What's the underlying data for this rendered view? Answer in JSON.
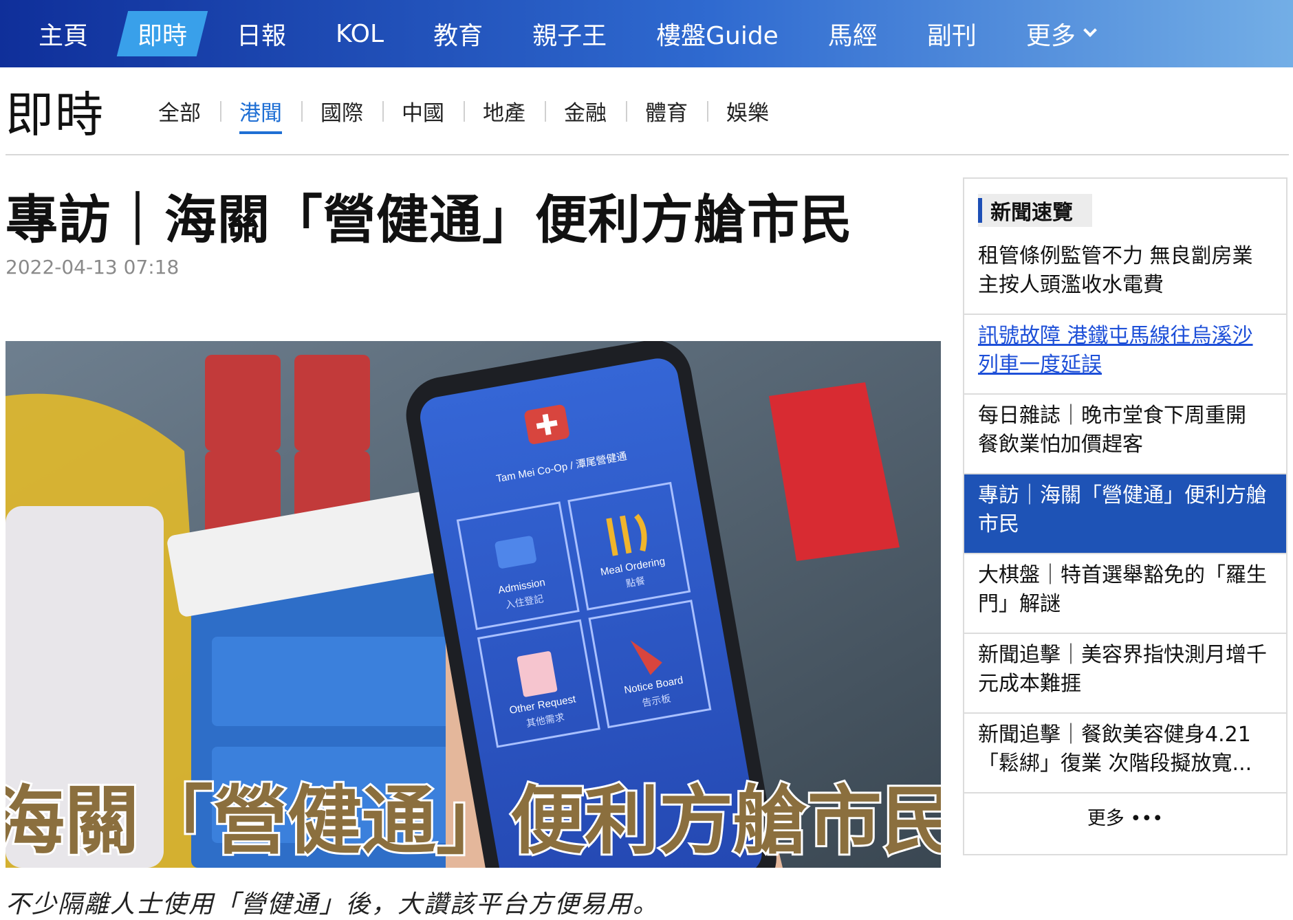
{
  "top_nav": {
    "items": [
      {
        "label": "主頁"
      },
      {
        "label": "即時"
      },
      {
        "label": "日報"
      },
      {
        "label": "KOL"
      },
      {
        "label": "教育"
      },
      {
        "label": "親子王"
      },
      {
        "label": "樓盤Guide"
      },
      {
        "label": "馬經"
      },
      {
        "label": "副刊"
      },
      {
        "label": "更多"
      }
    ],
    "active_index": 1,
    "more_icon": "chevron-down-icon"
  },
  "section": {
    "title": "即時",
    "tabs": [
      {
        "label": "全部"
      },
      {
        "label": "港聞"
      },
      {
        "label": "國際"
      },
      {
        "label": "中國"
      },
      {
        "label": "地產"
      },
      {
        "label": "金融"
      },
      {
        "label": "體育"
      },
      {
        "label": "娛樂"
      }
    ],
    "active_tab": "港聞"
  },
  "article": {
    "headline": "專訪｜海關「營健通」便利方艙市民",
    "date": "2022-04-13 07:18",
    "caption": "不少隔離人士使用「營健通」後，大讚該平台方便易用。",
    "image": {
      "overlay_text": "海關「營健通」便利方艙市民",
      "app_title": "Tam Mei Co-Op / 潭尾營健通",
      "tiles": [
        {
          "en": "Admission",
          "zh": "入住登記"
        },
        {
          "en": "Meal Ordering",
          "zh": "點餐"
        },
        {
          "en": "Other Request",
          "zh": "其他需求"
        },
        {
          "en": "Notice Board",
          "zh": "告示板"
        }
      ]
    }
  },
  "sidebar": {
    "title": "新聞速覽",
    "items": [
      {
        "text": "租管條例監管不力 無良劏房業主按人頭濫收水電費",
        "style": "normal"
      },
      {
        "text": "訊號故障 港鐵屯馬線往烏溪沙列車一度延誤",
        "style": "link"
      },
      {
        "text": "每日雜誌｜晚市堂食下周重開 餐飲業怕加價趕客",
        "style": "normal"
      },
      {
        "text": "專訪｜海關「營健通」便利方艙市民",
        "style": "active"
      },
      {
        "text": "大棋盤｜特首選舉豁免的「羅生門」解謎",
        "style": "normal"
      },
      {
        "text": "新聞追擊｜美容界指快測月增千元成本難捱",
        "style": "normal"
      },
      {
        "text": "新聞追擊｜餐飲美容健身4.21「鬆綁」復業 次階段擬放寬...",
        "style": "normal"
      }
    ],
    "more_label": "更多 •••"
  },
  "colors": {
    "nav_gradient_start": "#0f2f9a",
    "nav_gradient_end": "#73aee6",
    "nav_active": "#39a0ea",
    "accent_blue": "#1f6fd4",
    "sidebar_active": "#1e53b6"
  }
}
